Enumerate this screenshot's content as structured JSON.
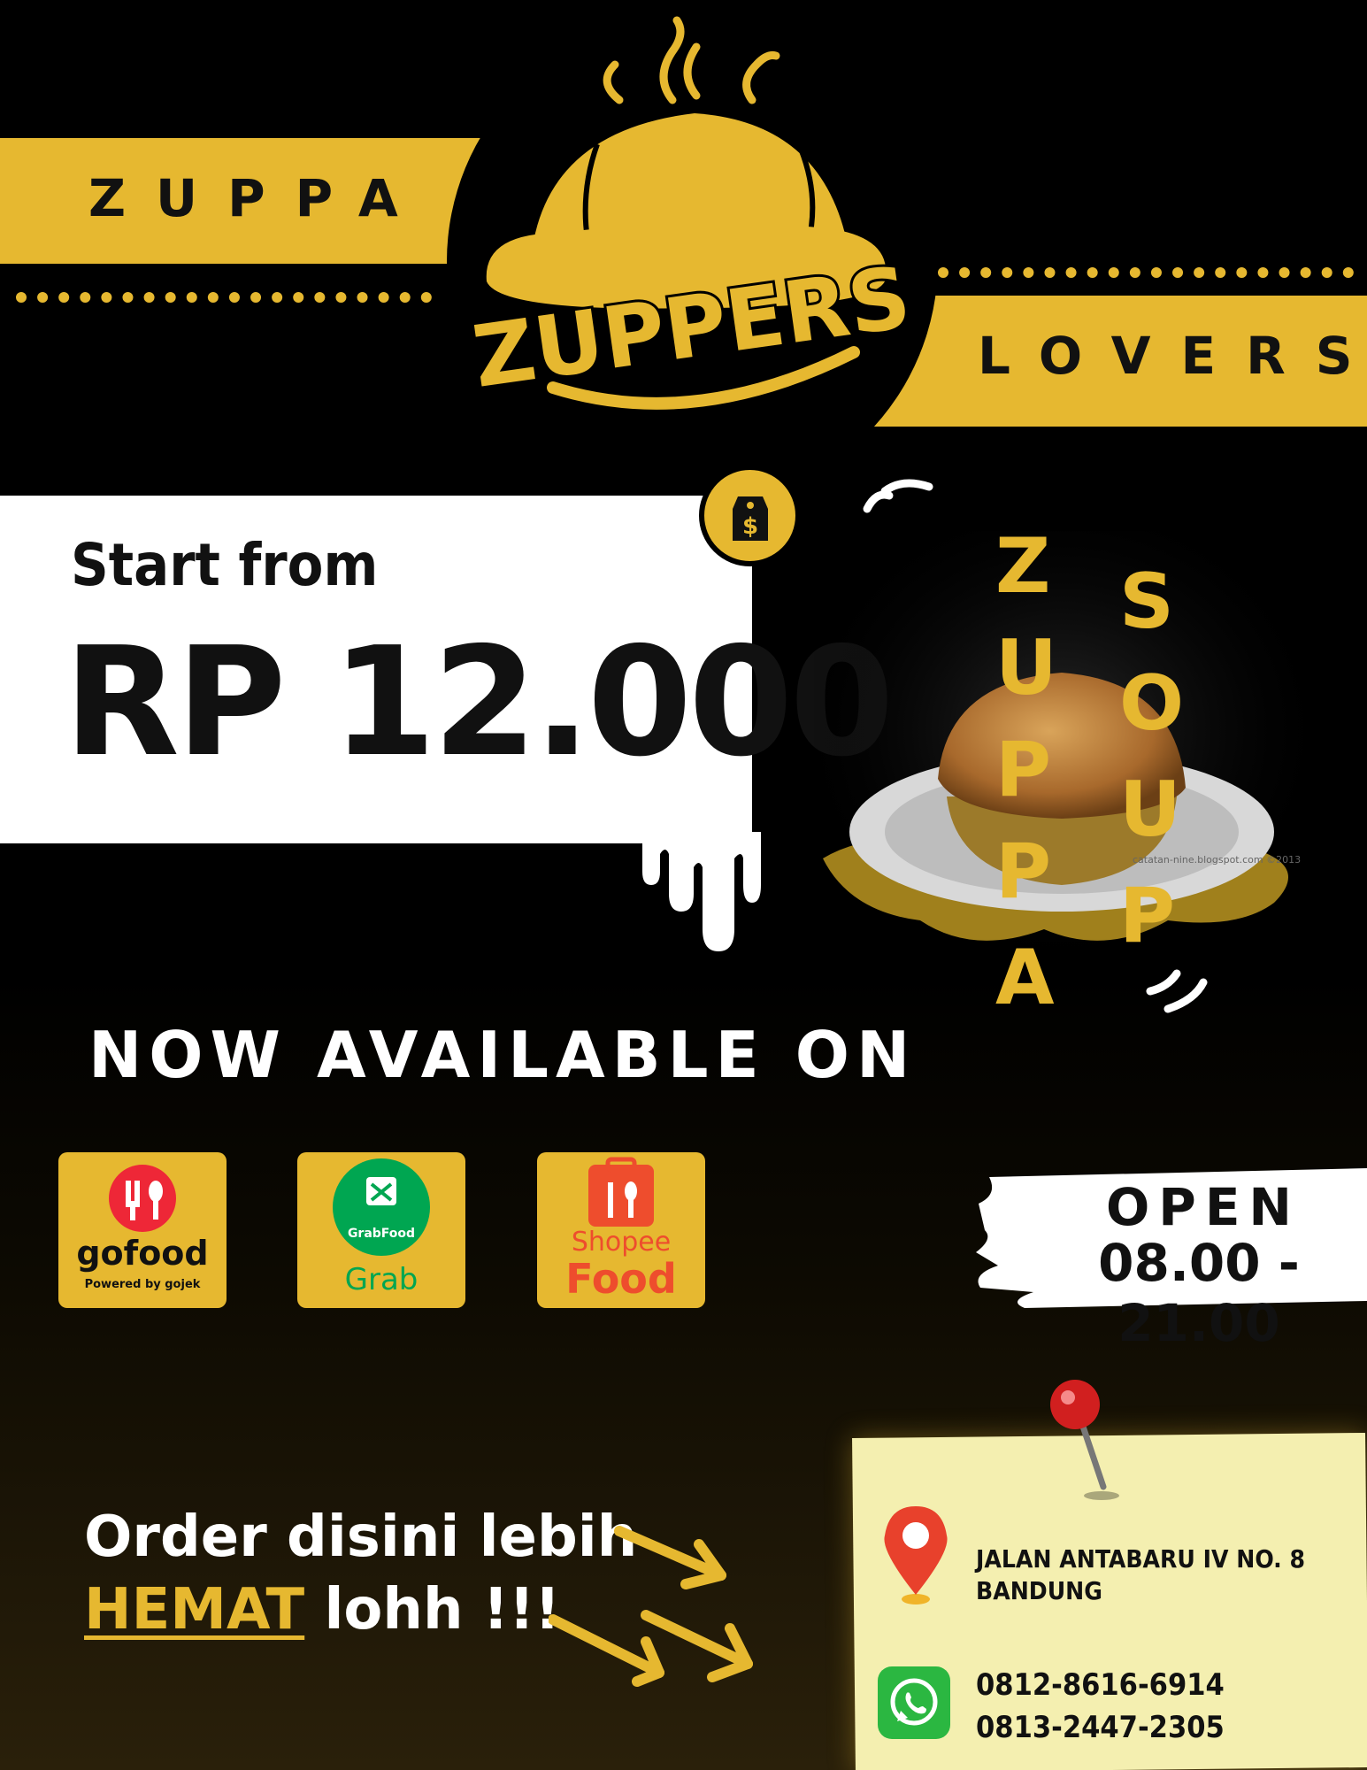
{
  "brand": {
    "left_band": "ZUPPA",
    "right_band": "LOVERS",
    "logo_text": "ZUPPERS"
  },
  "price": {
    "start_label": "Start from",
    "amount": "RP 12.000"
  },
  "product": {
    "word1": [
      "Z",
      "U",
      "P",
      "P",
      "A"
    ],
    "word2": [
      "S",
      "O",
      "U",
      "P"
    ],
    "watermark": "catatan-nine.blogspot.com ©2013"
  },
  "availability": {
    "heading": "NOW AVAILABLE ON",
    "apps": [
      {
        "name": "gofood",
        "sub": "Powered by gojek"
      },
      {
        "name": "Grab",
        "sub": "GrabFood"
      },
      {
        "name": "Food",
        "sub": "Shopee"
      }
    ]
  },
  "hours": {
    "title": "OPEN",
    "time": "08.00 - 21.00"
  },
  "order": {
    "line1": "Order disini lebih",
    "highlight": "HEMAT",
    "line2_rest": " lohh !!!"
  },
  "contact": {
    "address_line1": "JALAN ANTABARU IV NO. 8",
    "address_line2": "BANDUNG",
    "phone1": "0812-8616-6914",
    "phone2": "0813-2447-2305"
  },
  "colors": {
    "accent": "#e6b830",
    "background": "#000000",
    "note": "#f4efb0",
    "whatsapp": "#2bb741"
  }
}
